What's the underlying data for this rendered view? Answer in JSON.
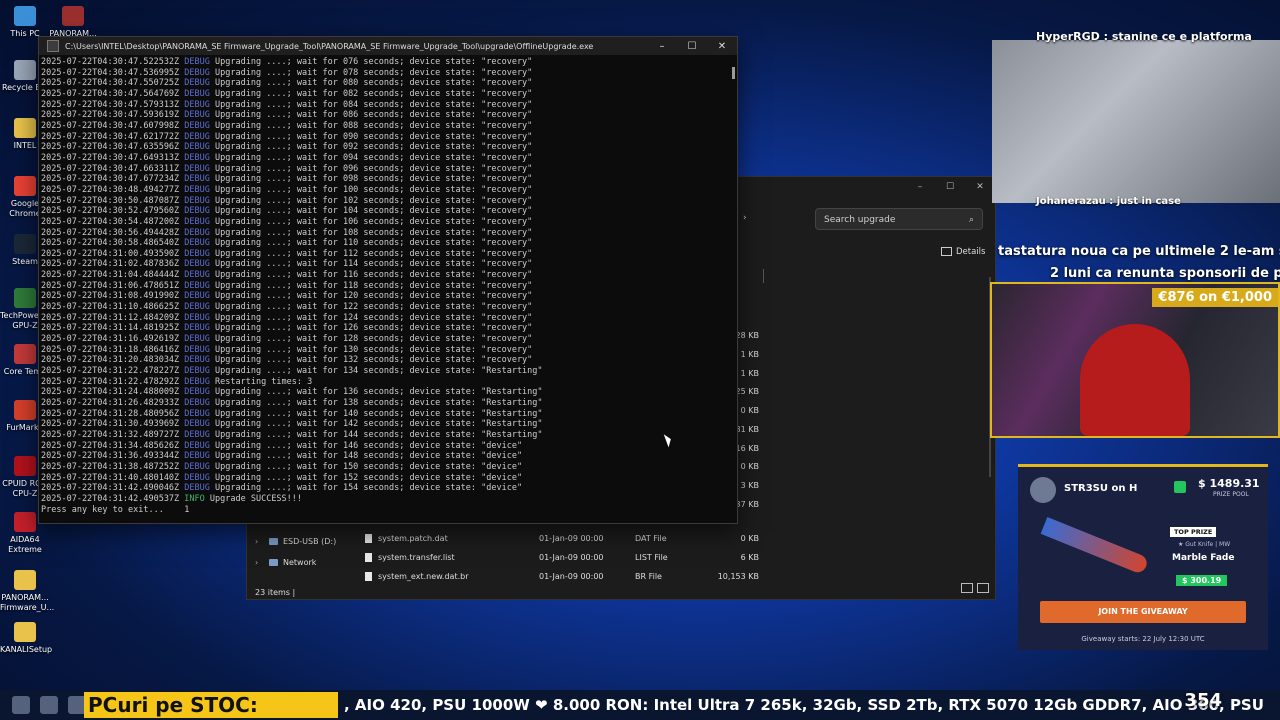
{
  "desktop_icons": [
    {
      "label": "This PC",
      "color": "#3b8fd6"
    },
    {
      "label": "PANORAM...",
      "color": "#9b2f2f"
    },
    {
      "label": "Recycle Bin",
      "color": "#9aa7b8"
    },
    {
      "label": "INTEL",
      "color": "#e8c24a"
    },
    {
      "label": "Google Chrome",
      "color": "#e94235"
    },
    {
      "label": "Steam",
      "color": "#1b2838"
    },
    {
      "label": "TechPowerUp GPU-Z",
      "color": "#2f7b3a"
    },
    {
      "label": "Core Temp",
      "color": "#c43a3a"
    },
    {
      "label": "FurMark2",
      "color": "#d6402a"
    },
    {
      "label": "CPUID ROG CPU-Z",
      "color": "#b3121d"
    },
    {
      "label": "AIDA64 Extreme",
      "color": "#c6202b"
    },
    {
      "label": "PANORAM... Firmware_U...",
      "color": "#e8c24a"
    },
    {
      "label": "KANALISetup",
      "color": "#e8c24a"
    }
  ],
  "console": {
    "title": "C:\\Users\\INTEL\\Desktop\\PANORAMA_SE Firmware_Upgrade_Tool\\PANORAMA_SE Firmware_Upgrade_Tool\\upgrade\\OfflineUpgrade.exe",
    "lines": [
      {
        "ts": "2025-07-22T04:30:47.522532Z",
        "level": "DEBUG",
        "msg": "Upgrading ....; wait for 076 seconds; device state: \"recovery\""
      },
      {
        "ts": "2025-07-22T04:30:47.536995Z",
        "level": "DEBUG",
        "msg": "Upgrading ....; wait for 078 seconds; device state: \"recovery\""
      },
      {
        "ts": "2025-07-22T04:30:47.550725Z",
        "level": "DEBUG",
        "msg": "Upgrading ....; wait for 080 seconds; device state: \"recovery\""
      },
      {
        "ts": "2025-07-22T04:30:47.564769Z",
        "level": "DEBUG",
        "msg": "Upgrading ....; wait for 082 seconds; device state: \"recovery\""
      },
      {
        "ts": "2025-07-22T04:30:47.579313Z",
        "level": "DEBUG",
        "msg": "Upgrading ....; wait for 084 seconds; device state: \"recovery\""
      },
      {
        "ts": "2025-07-22T04:30:47.593619Z",
        "level": "DEBUG",
        "msg": "Upgrading ....; wait for 086 seconds; device state: \"recovery\""
      },
      {
        "ts": "2025-07-22T04:30:47.607998Z",
        "level": "DEBUG",
        "msg": "Upgrading ....; wait for 088 seconds; device state: \"recovery\""
      },
      {
        "ts": "2025-07-22T04:30:47.621772Z",
        "level": "DEBUG",
        "msg": "Upgrading ....; wait for 090 seconds; device state: \"recovery\""
      },
      {
        "ts": "2025-07-22T04:30:47.635596Z",
        "level": "DEBUG",
        "msg": "Upgrading ....; wait for 092 seconds; device state: \"recovery\""
      },
      {
        "ts": "2025-07-22T04:30:47.649313Z",
        "level": "DEBUG",
        "msg": "Upgrading ....; wait for 094 seconds; device state: \"recovery\""
      },
      {
        "ts": "2025-07-22T04:30:47.663311Z",
        "level": "DEBUG",
        "msg": "Upgrading ....; wait for 096 seconds; device state: \"recovery\""
      },
      {
        "ts": "2025-07-22T04:30:47.677234Z",
        "level": "DEBUG",
        "msg": "Upgrading ....; wait for 098 seconds; device state: \"recovery\""
      },
      {
        "ts": "2025-07-22T04:30:48.494277Z",
        "level": "DEBUG",
        "msg": "Upgrading ....; wait for 100 seconds; device state: \"recovery\""
      },
      {
        "ts": "2025-07-22T04:30:50.487087Z",
        "level": "DEBUG",
        "msg": "Upgrading ....; wait for 102 seconds; device state: \"recovery\""
      },
      {
        "ts": "2025-07-22T04:30:52.479560Z",
        "level": "DEBUG",
        "msg": "Upgrading ....; wait for 104 seconds; device state: \"recovery\""
      },
      {
        "ts": "2025-07-22T04:30:54.487200Z",
        "level": "DEBUG",
        "msg": "Upgrading ....; wait for 106 seconds; device state: \"recovery\""
      },
      {
        "ts": "2025-07-22T04:30:56.494428Z",
        "level": "DEBUG",
        "msg": "Upgrading ....; wait for 108 seconds; device state: \"recovery\""
      },
      {
        "ts": "2025-07-22T04:30:58.486540Z",
        "level": "DEBUG",
        "msg": "Upgrading ....; wait for 110 seconds; device state: \"recovery\""
      },
      {
        "ts": "2025-07-22T04:31:00.493590Z",
        "level": "DEBUG",
        "msg": "Upgrading ....; wait for 112 seconds; device state: \"recovery\""
      },
      {
        "ts": "2025-07-22T04:31:02.487836Z",
        "level": "DEBUG",
        "msg": "Upgrading ....; wait for 114 seconds; device state: \"recovery\""
      },
      {
        "ts": "2025-07-22T04:31:04.484444Z",
        "level": "DEBUG",
        "msg": "Upgrading ....; wait for 116 seconds; device state: \"recovery\""
      },
      {
        "ts": "2025-07-22T04:31:06.478651Z",
        "level": "DEBUG",
        "msg": "Upgrading ....; wait for 118 seconds; device state: \"recovery\""
      },
      {
        "ts": "2025-07-22T04:31:08.491990Z",
        "level": "DEBUG",
        "msg": "Upgrading ....; wait for 120 seconds; device state: \"recovery\""
      },
      {
        "ts": "2025-07-22T04:31:10.486625Z",
        "level": "DEBUG",
        "msg": "Upgrading ....; wait for 122 seconds; device state: \"recovery\""
      },
      {
        "ts": "2025-07-22T04:31:12.484209Z",
        "level": "DEBUG",
        "msg": "Upgrading ....; wait for 124 seconds; device state: \"recovery\""
      },
      {
        "ts": "2025-07-22T04:31:14.481925Z",
        "level": "DEBUG",
        "msg": "Upgrading ....; wait for 126 seconds; device state: \"recovery\""
      },
      {
        "ts": "2025-07-22T04:31:16.492619Z",
        "level": "DEBUG",
        "msg": "Upgrading ....; wait for 128 seconds; device state: \"recovery\""
      },
      {
        "ts": "2025-07-22T04:31:18.486416Z",
        "level": "DEBUG",
        "msg": "Upgrading ....; wait for 130 seconds; device state: \"recovery\""
      },
      {
        "ts": "2025-07-22T04:31:20.483034Z",
        "level": "DEBUG",
        "msg": "Upgrading ....; wait for 132 seconds; device state: \"recovery\""
      },
      {
        "ts": "2025-07-22T04:31:22.478227Z",
        "level": "DEBUG",
        "msg": "Upgrading ....; wait for 134 seconds; device state: \"Restarting\""
      },
      {
        "ts": "2025-07-22T04:31:22.478292Z",
        "level": "DEBUG",
        "msg": "Restarting times: 3"
      },
      {
        "ts": "2025-07-22T04:31:24.488009Z",
        "level": "DEBUG",
        "msg": "Upgrading ....; wait for 136 seconds; device state: \"Restarting\""
      },
      {
        "ts": "2025-07-22T04:31:26.482933Z",
        "level": "DEBUG",
        "msg": "Upgrading ....; wait for 138 seconds; device state: \"Restarting\""
      },
      {
        "ts": "2025-07-22T04:31:28.480956Z",
        "level": "DEBUG",
        "msg": "Upgrading ....; wait for 140 seconds; device state: \"Restarting\""
      },
      {
        "ts": "2025-07-22T04:31:30.493969Z",
        "level": "DEBUG",
        "msg": "Upgrading ....; wait for 142 seconds; device state: \"Restarting\""
      },
      {
        "ts": "2025-07-22T04:31:32.489727Z",
        "level": "DEBUG",
        "msg": "Upgrading ....; wait for 144 seconds; device state: \"Restarting\""
      },
      {
        "ts": "2025-07-22T04:31:34.485626Z",
        "level": "DEBUG",
        "msg": "Upgrading ....; wait for 146 seconds; device state: \"device\""
      },
      {
        "ts": "2025-07-22T04:31:36.493344Z",
        "level": "DEBUG",
        "msg": "Upgrading ....; wait for 148 seconds; device state: \"device\""
      },
      {
        "ts": "2025-07-22T04:31:38.487252Z",
        "level": "DEBUG",
        "msg": "Upgrading ....; wait for 150 seconds; device state: \"device\""
      },
      {
        "ts": "2025-07-22T04:31:40.480140Z",
        "level": "DEBUG",
        "msg": "Upgrading ....; wait for 152 seconds; device state: \"device\""
      },
      {
        "ts": "2025-07-22T04:31:42.490046Z",
        "level": "DEBUG",
        "msg": "Upgrading ....; wait for 154 seconds; device state: \"device\""
      },
      {
        "ts": "2025-07-22T04:31:42.490537Z",
        "level": "INFO",
        "msg": "Upgrade SUCCESS!!!"
      }
    ],
    "prompt": "Press any key to exit...    1"
  },
  "explorer": {
    "search_placeholder": "Search upgrade",
    "details_label": "Details",
    "sizes": [
      "128 KB",
      "1 KB",
      "1 KB",
      "25 KB",
      "0 KB",
      "81 KB",
      "16 KB",
      "0 KB",
      "3 KB",
      "37 KB"
    ],
    "nav": [
      {
        "label": "ESD-USB (D:)"
      },
      {
        "label": "Network"
      }
    ],
    "files": [
      {
        "name": "system.patch.dat",
        "date": "01-Jan-09 00:00",
        "type": "DAT File",
        "size": "0 KB"
      },
      {
        "name": "system.transfer.list",
        "date": "01-Jan-09 00:00",
        "type": "LIST File",
        "size": "6 KB"
      },
      {
        "name": "system_ext.new.dat.br",
        "date": "01-Jan-09 00:00",
        "type": "BR File",
        "size": "10,153 KB"
      }
    ],
    "status": "23 items"
  },
  "stream": {
    "chat_top": "HyperRGD : stanine ce e platforma",
    "chat_bottom": "Johanerazau : just in case",
    "chat_line1": "tastatura noua ca pe ultimele 2 le-am s",
    "chat_line2": "2 luni ca renunta sponsorii de p",
    "price_badge": "€876 on €1,000",
    "giveaway": {
      "name": "STR3SU on H",
      "amount": "$ 1489.31",
      "prize_pool": "PRIZE POOL",
      "top_prize": "TOP PRIZE",
      "knife": "★ Gut Knife | MW",
      "skin": "Marble Fade",
      "skin_price": "$ 300.19",
      "join": "JOIN THE GIVEAWAY",
      "starts": "Giveaway starts: 22 July 12:30 UTC"
    },
    "ticker_label": "PCuri pe STOC:",
    "ticker_text": ", AIO 420, PSU 1000W  ❤ 8.000 RON: Intel Ultra 7 265k, 32Gb, SSD 2Tb, RTX 5070 12Gb GDDR7, AIO 360, PSU",
    "viewers": "354"
  }
}
